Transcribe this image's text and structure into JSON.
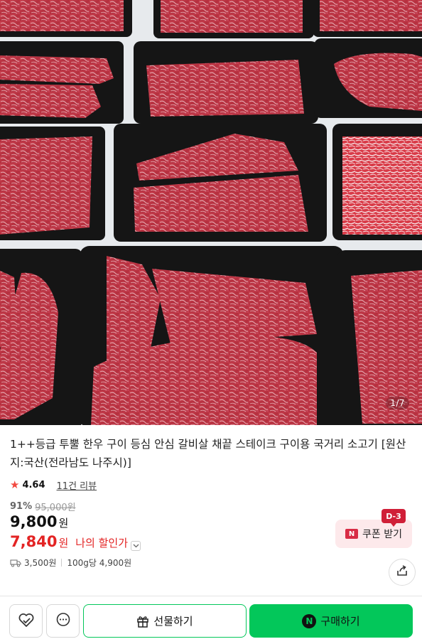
{
  "product": {
    "image_counter": "1/7",
    "title": "1++등급 투뿔 한우 구이 등심 안심 갈비살 채끝 스테이크 구이용 국거리 소고기 [원산지:국산(전라남도 나주시)]",
    "rating": "4.64",
    "review_link": "11건 리뷰",
    "discount_rate": "91%",
    "original_price": "95,000원",
    "price": "9,800",
    "price_unit": "원",
    "my_discount_price": "7,840",
    "my_discount_unit": "원",
    "my_discount_label": "나의 할인가",
    "shipping_fee": "3,500원",
    "unit_price": "100g당 4,900원"
  },
  "coupon": {
    "label": "쿠폰 받기",
    "badge": "D-3",
    "brand_letter": "N"
  },
  "actions": {
    "gift_label": "선물하기",
    "buy_label": "구매하기",
    "pay_letter": "N"
  },
  "icons": {
    "wishlist": "heart-icon",
    "talk": "chat-bubble-icon",
    "share": "share-icon",
    "gift": "gift-icon",
    "shipping": "truck-icon"
  },
  "colors": {
    "accent_green": "#03c75a",
    "discount_red": "#e32424",
    "coupon_bg": "#fde9eb",
    "badge_red": "#d01f38"
  }
}
